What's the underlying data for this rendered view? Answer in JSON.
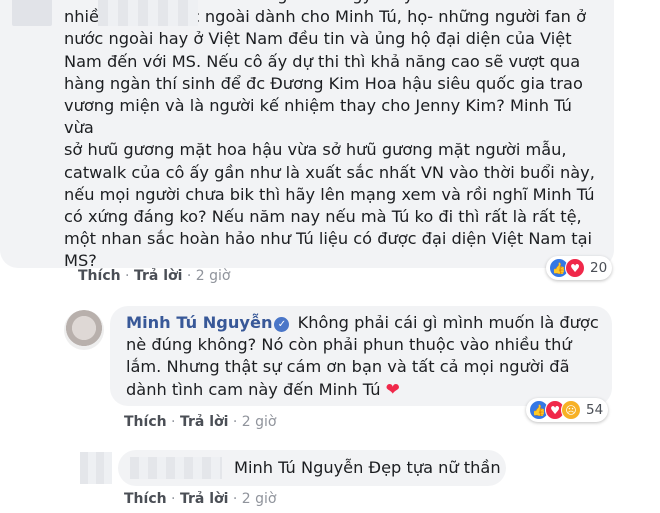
{
  "comment1": {
    "text": "Tôi đọc bình luận trên trang Missology thấy có rất\nnhiều fan ở nước ngoài dành cho Minh Tú, họ- những người fan ở\nnước ngoài hay ở Việt Nam đều tin và ủng hộ đại diện của Việt\nNam đến với MS. Nếu cô ấy dự thi thì khả năng cao sẽ vượt qua\nhàng ngàn thí sinh để đc Đương Kim Hoa hậu siêu quốc gia trao\nvương miện và là người kế nhiệm thay cho Jenny Kim? Minh Tú vừa\nsở hưũ gương mặt hoa hậu vừa sở hưũ gương mặt người mẫu,\ncatwalk của cô ấy gần như là xuất sắc nhất VN vào thời buổi này,\nnếu mọi người chưa bik thì hãy lên mạng xem và rồi nghĩ Minh Tú\ncó xứng đáng ko? Nếu năm nay nếu mà Tú ko đi thì rất là rất tệ,\nmột nhan sắc hoàn hảo như Tú liệu có được đại diện Việt Nam tại\nMS?",
    "like_label": "Thích",
    "reply_label": "Trả lời",
    "separator": "·",
    "time": "2 giờ",
    "reactions": {
      "icons": [
        "like",
        "love"
      ],
      "count": "20"
    }
  },
  "comment2": {
    "author": "Minh Tú Nguyễn",
    "text": " Không phải cái gì mình muốn là được nè đúng không? Nó còn phải phun thuộc vào nhiều thứ lắm. Nhưng thật sự cám ơn bạn và tất cả mọi người đã dành tình cam này đến Minh Tú ",
    "emoji": "❤",
    "like_label": "Thích",
    "reply_label": "Trả lời",
    "separator": "·",
    "time": "2 giờ",
    "reactions": {
      "icons": [
        "like",
        "love",
        "sad"
      ],
      "count": "54"
    }
  },
  "comment3": {
    "text": "Minh Tú Nguyễn Đẹp tựa nữ thần",
    "like_label": "Thích",
    "reply_label": "Trả lời",
    "separator": "·",
    "time": "2 giờ"
  },
  "colors": {
    "bubble": "#f2f3f5",
    "link": "#385898",
    "like": "#3578e5",
    "love": "#f0284a",
    "sad": "#f7b125"
  }
}
